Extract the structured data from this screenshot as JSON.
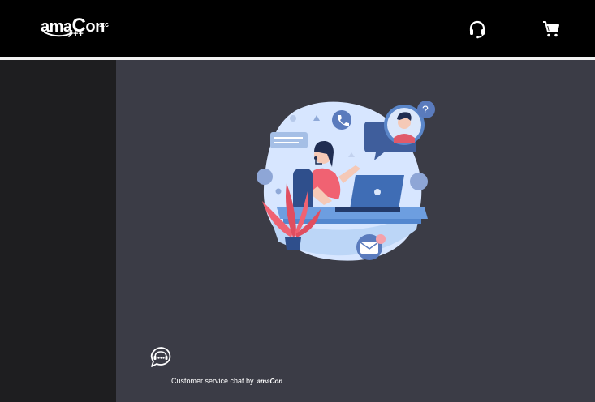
{
  "header": {
    "logo": {
      "prefix": "ama",
      "big": "C",
      "suffix": "on",
      "tld": ".zc",
      "plus": "++"
    },
    "support_icon": "headset-icon",
    "cart_icon": "cart-icon"
  },
  "main": {
    "illustration": "customer-support-illustration",
    "chat_icon": "chat-bubble-icon",
    "footer_text": "Customer service chat by",
    "footer_brand": "amaCon"
  },
  "colors": {
    "topbar": "#000000",
    "sidebar": "#1e1e20",
    "main_bg": "#3b3c46",
    "illus_blob": "#d7e6ff",
    "accent_red": "#f06272",
    "accent_blue": "#3f6db5"
  }
}
